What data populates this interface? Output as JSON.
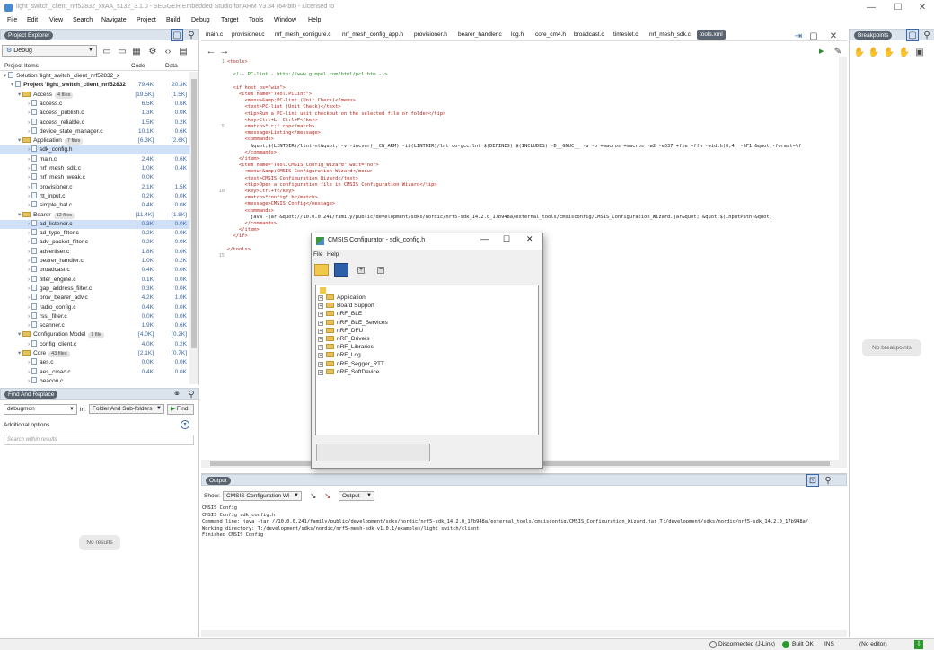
{
  "window": {
    "title": "light_switch_client_nrf52832_xxAA_s132_3.1.0 - SEGGER Embedded Studio for ARM V3.34 (64-bit) - Licensed to"
  },
  "menu": [
    "File",
    "Edit",
    "View",
    "Search",
    "Navigate",
    "Project",
    "Build",
    "Debug",
    "Target",
    "Tools",
    "Window",
    "Help"
  ],
  "project_explorer": {
    "title": "Project Explorer",
    "config": "Debug",
    "col_items": "Project Items",
    "col_code": "Code",
    "col_data": "Data",
    "rows": [
      {
        "label": "Solution 'light_switch_client_nrf52832_x",
        "code": "",
        "data": "",
        "type": "sol",
        "lvl": 0
      },
      {
        "label": "Project 'light_switch_client_nrf52832",
        "code": "79.4K",
        "data": "20.3K",
        "type": "proj",
        "lvl": 1
      },
      {
        "label": "Access",
        "badge": "4 files",
        "code": "[19.5K]",
        "data": "[1.5K]",
        "type": "folder",
        "lvl": 2
      },
      {
        "label": "access.c",
        "code": "6.5K",
        "data": "0.6K",
        "type": "file",
        "lvl": 3
      },
      {
        "label": "access_publish.c",
        "code": "1.3K",
        "data": "0.0K",
        "type": "file",
        "lvl": 3
      },
      {
        "label": "access_reliable.c",
        "code": "1.5K",
        "data": "0.2K",
        "type": "file",
        "lvl": 3
      },
      {
        "label": "device_state_manager.c",
        "code": "10.1K",
        "data": "0.6K",
        "type": "file",
        "lvl": 3
      },
      {
        "label": "Application",
        "badge": "7 files",
        "code": "[6.3K]",
        "data": "[2.6K]",
        "type": "folder",
        "lvl": 2
      },
      {
        "label": "sdk_config.h",
        "code": "",
        "data": "",
        "type": "file",
        "lvl": 3,
        "sel": true
      },
      {
        "label": "main.c",
        "code": "2.4K",
        "data": "0.6K",
        "type": "file",
        "lvl": 3
      },
      {
        "label": "nrf_mesh_sdk.c",
        "code": "1.0K",
        "data": "0.4K",
        "type": "file",
        "lvl": 3
      },
      {
        "label": "nrf_mesh_weak.c",
        "code": "0.0K",
        "data": "",
        "type": "file",
        "lvl": 3
      },
      {
        "label": "provisioner.c",
        "code": "2.1K",
        "data": "1.5K",
        "type": "file",
        "lvl": 3
      },
      {
        "label": "rtt_input.c",
        "code": "0.2K",
        "data": "0.0K",
        "type": "file",
        "lvl": 3
      },
      {
        "label": "simple_hal.c",
        "code": "0.4K",
        "data": "0.0K",
        "type": "file",
        "lvl": 3
      },
      {
        "label": "Bearer",
        "badge": "12 files",
        "code": "[11.4K]",
        "data": "[1.8K]",
        "type": "folder",
        "lvl": 2
      },
      {
        "label": "ad_listener.c",
        "code": "0.3K",
        "data": "0.0K",
        "type": "file",
        "lvl": 3,
        "sel": true
      },
      {
        "label": "ad_type_filter.c",
        "code": "0.2K",
        "data": "0.0K",
        "type": "file",
        "lvl": 3
      },
      {
        "label": "adv_packet_filter.c",
        "code": "0.2K",
        "data": "0.0K",
        "type": "file",
        "lvl": 3
      },
      {
        "label": "advertiser.c",
        "code": "1.8K",
        "data": "0.0K",
        "type": "file",
        "lvl": 3
      },
      {
        "label": "bearer_handler.c",
        "code": "1.0K",
        "data": "0.2K",
        "type": "file",
        "lvl": 3
      },
      {
        "label": "broadcast.c",
        "code": "0.4K",
        "data": "0.0K",
        "type": "file",
        "lvl": 3
      },
      {
        "label": "filter_engine.c",
        "code": "0.1K",
        "data": "0.0K",
        "type": "file",
        "lvl": 3
      },
      {
        "label": "gap_address_filter.c",
        "code": "0.3K",
        "data": "0.0K",
        "type": "file",
        "lvl": 3
      },
      {
        "label": "prov_bearer_adv.c",
        "code": "4.2K",
        "data": "1.0K",
        "type": "file",
        "lvl": 3
      },
      {
        "label": "radio_config.c",
        "code": "0.4K",
        "data": "0.0K",
        "type": "file",
        "lvl": 3
      },
      {
        "label": "rssi_filter.c",
        "code": "0.0K",
        "data": "0.0K",
        "type": "file",
        "lvl": 3
      },
      {
        "label": "scanner.c",
        "code": "1.9K",
        "data": "0.6K",
        "type": "file",
        "lvl": 3
      },
      {
        "label": "Configuration Model",
        "badge": "1 file",
        "code": "[4.0K]",
        "data": "[0.2K]",
        "type": "folder",
        "lvl": 2
      },
      {
        "label": "config_client.c",
        "code": "4.0K",
        "data": "0.2K",
        "type": "file",
        "lvl": 3
      },
      {
        "label": "Core",
        "badge": "43 files",
        "code": "[2.1K]",
        "data": "[0.7K]",
        "type": "folder",
        "lvl": 2
      },
      {
        "label": "aes.c",
        "code": "0.0K",
        "data": "0.0K",
        "type": "file",
        "lvl": 3
      },
      {
        "label": "aes_cmac.c",
        "code": "0.4K",
        "data": "0.0K",
        "type": "file",
        "lvl": 3
      },
      {
        "label": "beacon.c",
        "code": "",
        "data": "",
        "type": "file",
        "lvl": 3
      }
    ]
  },
  "find_replace": {
    "title": "Find And Replace",
    "search_value": "debugmon",
    "in_label": "in:",
    "scope": "Folder And Sub-folders",
    "find_label": "Find",
    "additional": "Additional options",
    "results_placeholder": "Search within results",
    "no_results": "No results"
  },
  "editor": {
    "tabs": [
      "main.c",
      "provisioner.c",
      "nrf_mesh_configure.c",
      "nrf_mesh_config_app.h",
      "provisioner.h",
      "bearer_handler.c",
      "log.h",
      "core_cm4.h",
      "broadcast.c",
      "timeslot.c",
      "nrf_mesh_sdk.c",
      "tools.xml"
    ],
    "active_tab": "tools.xml",
    "line_numbers": [
      "1",
      "5",
      "10",
      "15"
    ],
    "code": [
      {
        "p": "<tools>",
        "c": "tg"
      },
      {
        "p": "",
        "c": ""
      },
      {
        "p": "  <!-- PC-lint - http://www.gimpel.com/html/pcl.htm -->",
        "c": "cm"
      },
      {
        "p": "",
        "c": ""
      },
      {
        "p": "  <if host_os=\"win\">",
        "c": "tg"
      },
      {
        "p": "    <item name=\"Tool.PCLint\">",
        "c": "tg"
      },
      {
        "p": "      <menu>&amp;PC-lint (Unit Check)</menu>",
        "c": "tg"
      },
      {
        "p": "      <text>PC-lint (Unit Check)</text>",
        "c": "tg"
      },
      {
        "p": "      <tip>Run a PC-lint unit checkout on the selected file or folder</tip>",
        "c": "tg"
      },
      {
        "p": "      <key>Ctrl+L, Ctrl+P</key>",
        "c": "tg"
      },
      {
        "p": "      <match>*.c;*.cpp</match>",
        "c": "tg"
      },
      {
        "p": "      <message>Linting</message>",
        "c": "tg"
      },
      {
        "p": "      <commands>",
        "c": "tg"
      },
      {
        "p": "        &quot;$(LINTDIR)/lint-nt&quot; -v -incvar(__CW_ARM) -i$(LINTDIR)/lnt co-gcc.lnt $(DEFINES) $(INCLUDES) -D__GNUC__ -u -b +macros +macros -w2 -e537 +fie +ffn -width(0,4) -hF1 &quot;-format=%f",
        "c": ""
      },
      {
        "p": "      </commands>",
        "c": "tg"
      },
      {
        "p": "    </item>",
        "c": "tg"
      },
      {
        "p": "    <item name=\"Tool.CMSIS_Config_Wizard\" wait=\"no\">",
        "c": "tg"
      },
      {
        "p": "      <menu>&amp;CMSIS Configuration Wizard</menu>",
        "c": "tg"
      },
      {
        "p": "      <text>CMSIS Configuration Wizard</text>",
        "c": "tg"
      },
      {
        "p": "      <tip>Open a configuration file in CMSIS Configuration Wizard</tip>",
        "c": "tg"
      },
      {
        "p": "      <key>Ctrl+Y</key>",
        "c": "tg"
      },
      {
        "p": "      <match>*config*.h</match>",
        "c": "tg"
      },
      {
        "p": "      <message>CMSIS Config</message>",
        "c": "tg"
      },
      {
        "p": "      <commands>",
        "c": "tg"
      },
      {
        "p": "        java -jar &quot;//10.0.0.241/family/public/development/sdks/nordic/nrf5-sdk_14.2.0_17b948a/external_tools/cmsisconfig/CMSIS_Configuration_Wizard.jar&quot; &quot;$(InputPath)&quot;",
        "c": ""
      },
      {
        "p": "      </commands>",
        "c": "tg"
      },
      {
        "p": "    </item>",
        "c": "tg"
      },
      {
        "p": "  </if>",
        "c": "tg"
      },
      {
        "p": "",
        "c": ""
      },
      {
        "p": "</tools>",
        "c": "tg"
      }
    ]
  },
  "output": {
    "title": "Output",
    "show_label": "Show:",
    "show_value": "CMSIS Configuration Wi",
    "target_value": "Output",
    "lines": [
      "CMSIS Config",
      "CMSIS Config sdk_config.h",
      "Command line: java -jar //10.0.0.241/family/public/development/sdks/nordic/nrf5-sdk_14.2.0_17b948a/external_tools/cmsisconfig/CMSIS_Configuration_Wizard.jar T:/development/sdks/nordic/nrf5-sdk_14.2.0_17b948a/",
      "Working directory: T:/development/sdks/nordic/nrf5-mesh-sdk_v1.0.1/examples/light_switch/client",
      "Finished CMSIS Config"
    ]
  },
  "breakpoints": {
    "title": "Breakpoints",
    "empty": "No breakpoints"
  },
  "dialog": {
    "title": "CMSIS Configurator - sdk_config.h",
    "menu": [
      "File",
      "Help"
    ],
    "items": [
      "Application",
      "Board Support",
      "nRF_BLE",
      "nRF_BLE_Services",
      "nRF_DFU",
      "nRF_Drivers",
      "nRF_Libraries",
      "nRF_Log",
      "nRF_Segger_RTT",
      "nRF_SoftDevice"
    ]
  },
  "status": {
    "disconnected": "Disconnected (J-Link)",
    "built": "Built OK",
    "ins": "INS",
    "editor": "(No editor)"
  },
  "colors": {
    "accent": "#3a67a8",
    "panel_header": "#dbe3ec",
    "selection": "#cfe0f7"
  }
}
